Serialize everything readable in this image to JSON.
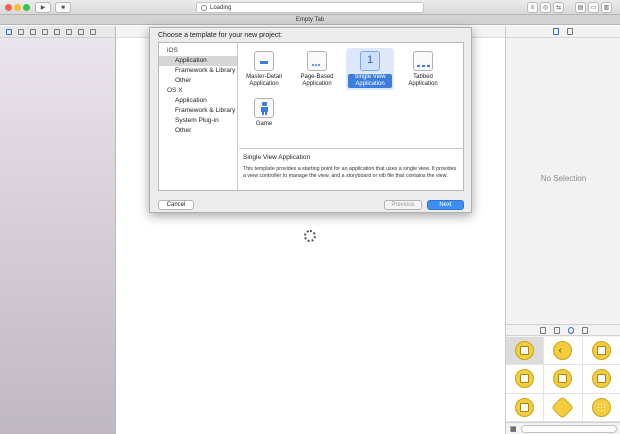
{
  "toolbar": {
    "activity_text": "Loading"
  },
  "tabbar": {
    "title": "Empty Tab"
  },
  "inspector": {
    "no_selection": "No Selection"
  },
  "sheet": {
    "title": "Choose a template for your new project:",
    "categories": [
      {
        "group": "iOS",
        "items": [
          "Application",
          "Framework & Library",
          "Other"
        ]
      },
      {
        "group": "OS X",
        "items": [
          "Application",
          "Framework & Library",
          "System Plug-in",
          "Other"
        ]
      }
    ],
    "selected_category": "Application",
    "templates": [
      {
        "label": "Master-Detail Application",
        "icon": "master-detail-icon"
      },
      {
        "label": "Page-Based Application",
        "icon": "page-based-icon"
      },
      {
        "label": "Single View Application",
        "icon": "single-view-icon"
      },
      {
        "label": "Tabbed Application",
        "icon": "tabbed-icon"
      },
      {
        "label": "Game",
        "icon": "game-icon"
      }
    ],
    "selected_template": "Single View Application",
    "description": {
      "title": "Single View Application",
      "text": "This template provides a starting point for an application that uses a single view. It provides a view controller to manage the view, and a storyboard or nib file that contains the view."
    },
    "buttons": {
      "cancel": "Cancel",
      "previous": "Previous",
      "next": "Next"
    }
  },
  "colors": {
    "accent": "#3e8ef2",
    "selection_blue": "#3d7ddc",
    "library_yellow": "#f3cd3c"
  }
}
